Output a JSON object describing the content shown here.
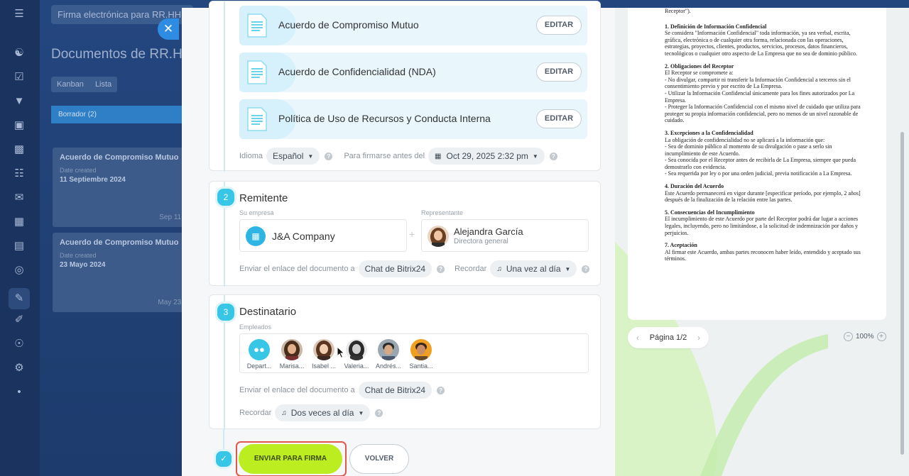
{
  "background": {
    "search_placeholder": "Firma electrónica para RR.HH.",
    "title": "Documentos de RR.HH",
    "views": [
      "Kanban",
      "Lista"
    ],
    "column_title": "Borrador",
    "column_count": "(2)",
    "cards": [
      {
        "title": "Acuerdo de Compromiso Mutuo",
        "label": "Date created",
        "date": "11 Septiembre 2024",
        "short_date": "Sep 11,"
      },
      {
        "title": "Acuerdo de Compromiso Mutuo",
        "label": "Date created",
        "date": "23 Mayo 2024",
        "short_date": "May 23,"
      }
    ]
  },
  "documents": [
    {
      "title": "Acuerdo de Compromiso Mutuo",
      "edit_label": "EDITAR"
    },
    {
      "title": "Acuerdo de Confidencialidad (NDA)",
      "edit_label": "EDITAR"
    },
    {
      "title": "Política de Uso de Recursos y Conducta Interna",
      "edit_label": "EDITAR"
    }
  ],
  "doc_settings": {
    "language_label": "Idioma",
    "language_value": "Español",
    "deadline_label": "Para firmarse antes del",
    "deadline_value": "Oct 29, 2025 2:32 pm"
  },
  "sender": {
    "step": "2",
    "title": "Remitente",
    "company_label": "Su empresa",
    "company_name": "J&A Company",
    "rep_label": "Representante",
    "rep_name": "Alejandra García",
    "rep_role": "Directora general",
    "send_link_label": "Enviar el enlace del documento a",
    "send_link_value": "Chat de Bitrix24",
    "remind_label": "Recordar",
    "remind_value": "Una vez al día"
  },
  "recipient": {
    "step": "3",
    "title": "Destinatario",
    "employees_label": "Empleados",
    "employees": [
      "Depart...",
      "Marisa...",
      "Isabel ...",
      "Valeria...",
      "Andrés...",
      "Santia..."
    ],
    "send_link_label": "Enviar el enlace del documento a",
    "send_link_value": "Chat de Bitrix24",
    "remind_label": "Recordar",
    "remind_value": "Dos veces al día"
  },
  "actions": {
    "send_label": "ENVIAR PARA FIRMA",
    "back_label": "VOLVER"
  },
  "preview": {
    "intro": "Receptor\").",
    "sections": [
      {
        "heading": "1. Definición de Información Confidencial",
        "body": "Se considera \"Información Confidencial\" toda información, ya sea verbal, escrita, gráfica, electrónica o de cualquier otra forma, relacionada con las operaciones, estrategias, proyectos, clientes, productos, servicios, procesos, datos financieros, tecnológicos o cualquier otro aspecto de La Empresa que no sea de dominio público."
      },
      {
        "heading": "2. Obligaciones del Receptor",
        "body": "El Receptor se compromete a:\n- No divulgar, compartir ni transferir la Información Confidencial a terceros sin el consentimiento previo y por escrito de La Empresa.\n- Utilizar la Información Confidencial únicamente para los fines autorizados por La Empresa.\n- Proteger la Información Confidencial con el mismo nivel de cuidado que utiliza para proteger su propia información confidencial, pero no menos de un nivel razonable de cuidado."
      },
      {
        "heading": "3. Excepciones a la Confidencialidad",
        "body": "La obligación de confidencialidad no se aplicará a la información que:\n- Sea de dominio público al momento de su divulgación o pase a serlo sin incumplimiento de este Acuerdo.\n- Sea conocida por el Receptor antes de recibirla de La Empresa, siempre que pueda demostrarlo con evidencia.\n- Sea requerida por ley o por una orden judicial, previa notificación a La Empresa."
      },
      {
        "heading": "4. Duración del Acuerdo",
        "body": "Este Acuerdo permanecerá en vigor durante [especificar período, por ejemplo, 2 años] después de la finalización de la relación entre las partes."
      },
      {
        "heading": "5. Consecuencias del Incumplimiento",
        "body": "El incumplimiento de este Acuerdo por parte del Receptor podrá dar lugar a acciones legales, incluyendo, pero no limitándose, a la solicitud de indemnización por daños y perjuicios."
      },
      {
        "heading": "7. Aceptación",
        "body": "Al firmar este Acuerdo, ambas partes reconocen haber leído, entendido y aceptado sus términos."
      }
    ],
    "page_label": "Página 1/2",
    "zoom_value": "100%"
  },
  "colors": {
    "accent": "#37c6e6",
    "send_button": "#bbed21",
    "highlight": "#e2574c"
  }
}
